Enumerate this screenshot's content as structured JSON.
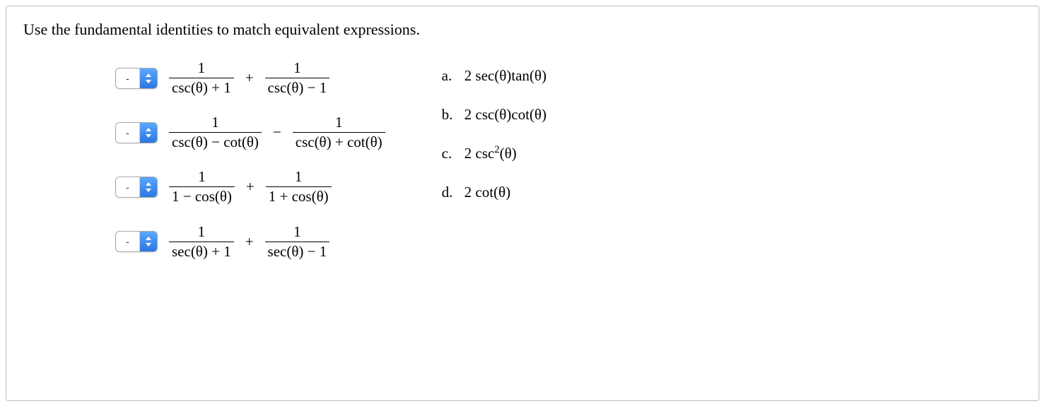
{
  "prompt": "Use the fundamental identities to match equivalent expressions.",
  "selector_value": "-",
  "questions": [
    {
      "frac1_num": "1",
      "frac1_den": "csc(θ) + 1",
      "op": "+",
      "frac2_num": "1",
      "frac2_den": "csc(θ) − 1"
    },
    {
      "frac1_num": "1",
      "frac1_den": "csc(θ) − cot(θ)",
      "op": "−",
      "frac2_num": "1",
      "frac2_den": "csc(θ) + cot(θ)"
    },
    {
      "frac1_num": "1",
      "frac1_den": "1 − cos(θ)",
      "op": "+",
      "frac2_num": "1",
      "frac2_den": "1 + cos(θ)"
    },
    {
      "frac1_num": "1",
      "frac1_den": "sec(θ) + 1",
      "op": "+",
      "frac2_num": "1",
      "frac2_den": "sec(θ) − 1"
    }
  ],
  "answers": [
    {
      "letter": "a.",
      "text": "2 sec(θ)tan(θ)"
    },
    {
      "letter": "b.",
      "text": "2 csc(θ)cot(θ)"
    },
    {
      "letter": "c.",
      "text_pre": "2 csc",
      "sup": "2",
      "text_post": "(θ)"
    },
    {
      "letter": "d.",
      "text": "2 cot(θ)"
    }
  ]
}
